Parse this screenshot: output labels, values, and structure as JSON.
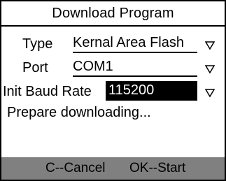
{
  "title": "Download Program",
  "fields": [
    {
      "label": "Type",
      "value": "Kernal Area Flash"
    },
    {
      "label": "Port",
      "value": "COM1"
    },
    {
      "label": "Init Baud Rate",
      "value": "115200"
    }
  ],
  "status": "Prepare downloading...",
  "footer": {
    "cancel": "C--Cancel",
    "start": "OK--Start"
  },
  "icons": {
    "dropdown": "down-triangle-outline"
  }
}
